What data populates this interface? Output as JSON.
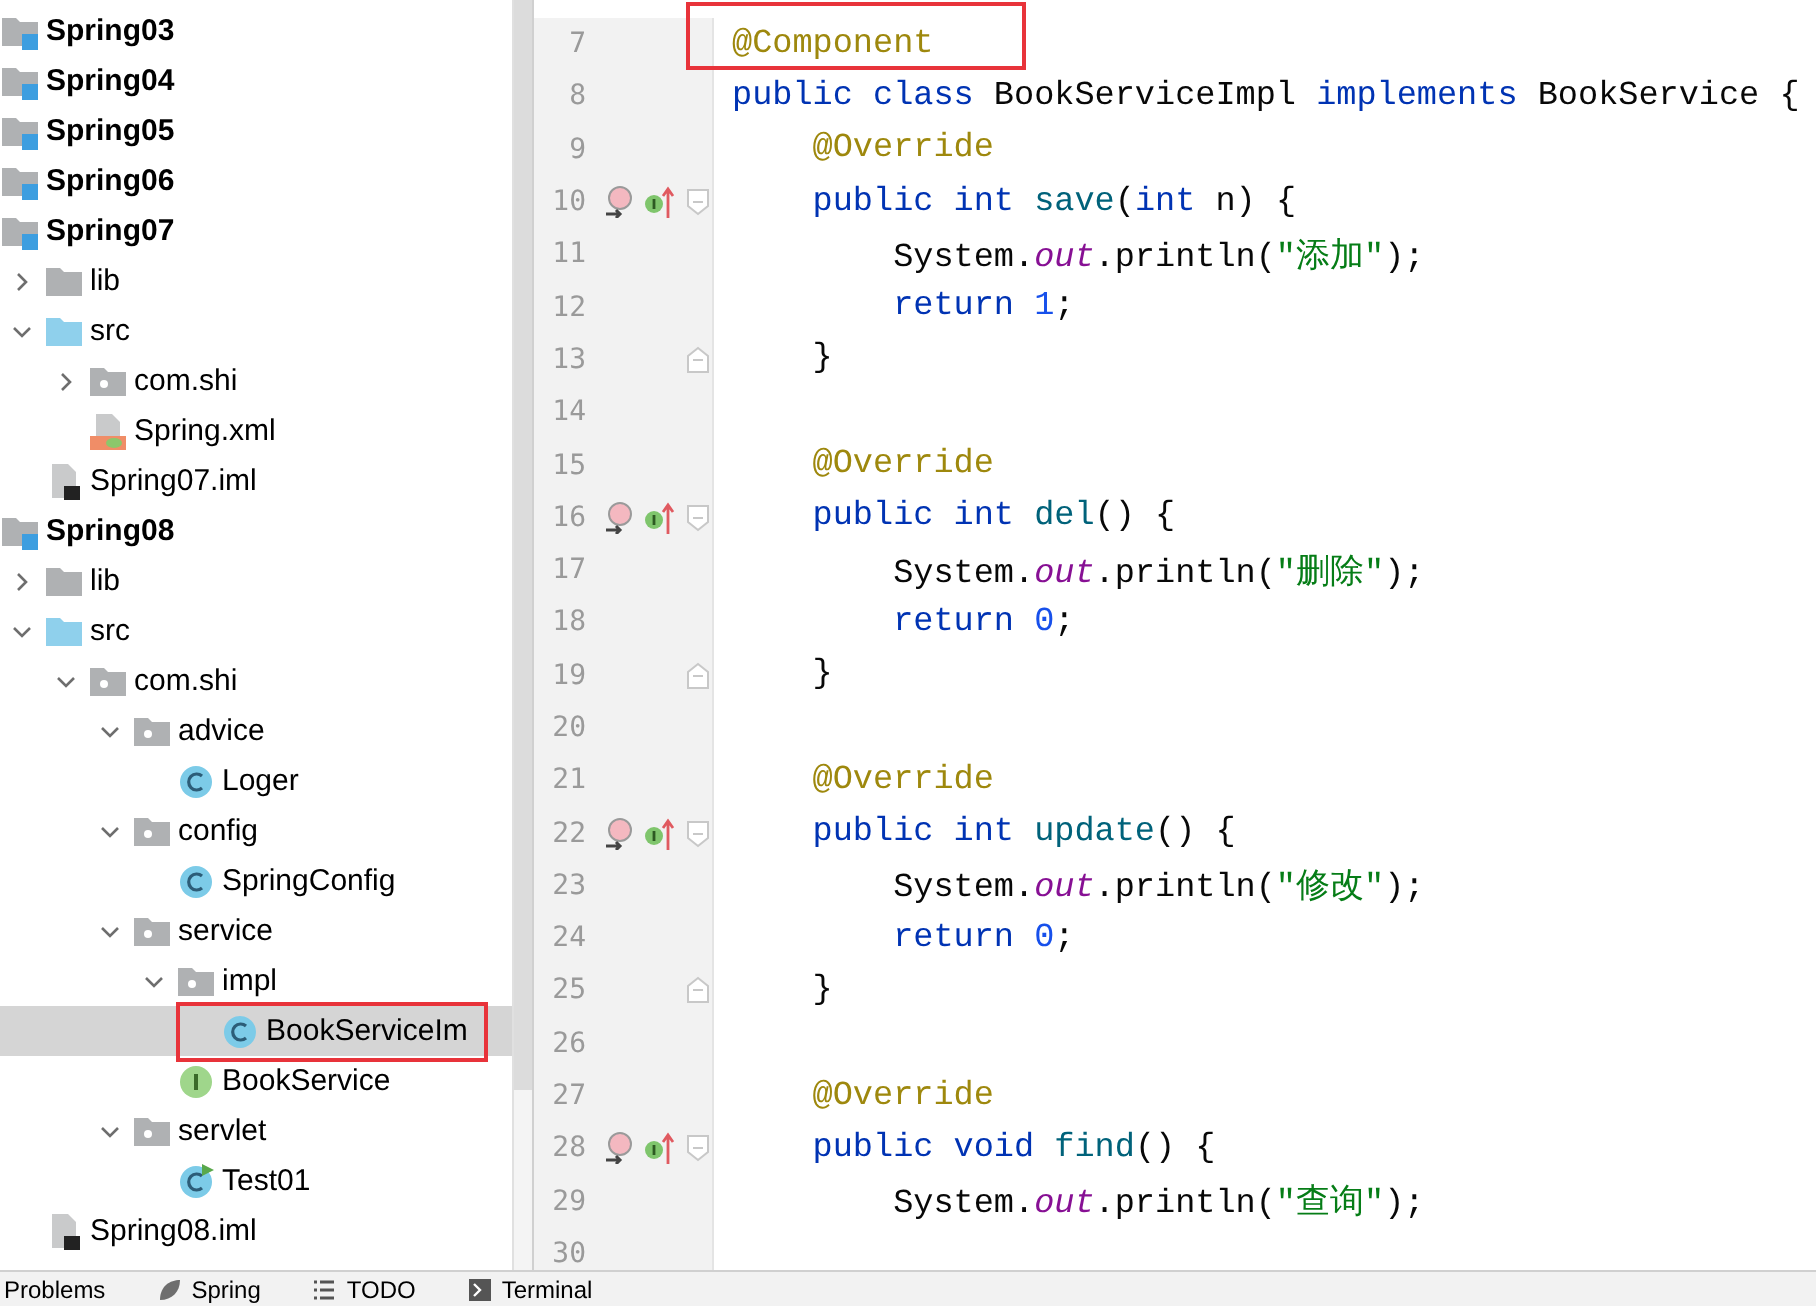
{
  "project_tree": [
    {
      "label": "Spring03",
      "kind": "module"
    },
    {
      "label": "Spring04",
      "kind": "module"
    },
    {
      "label": "Spring05",
      "kind": "module"
    },
    {
      "label": "Spring06",
      "kind": "module"
    },
    {
      "label": "Spring07",
      "kind": "module",
      "children": [
        {
          "label": "lib",
          "kind": "folder",
          "expanded": false
        },
        {
          "label": "src",
          "kind": "source-folder",
          "expanded": true,
          "children": [
            {
              "label": "com.shi",
              "kind": "package",
              "expanded": false
            },
            {
              "label": "Spring.xml",
              "kind": "xml"
            }
          ]
        },
        {
          "label": "Spring07.iml",
          "kind": "iml"
        }
      ]
    },
    {
      "label": "Spring08",
      "kind": "module",
      "children": [
        {
          "label": "lib",
          "kind": "folder",
          "expanded": false
        },
        {
          "label": "src",
          "kind": "source-folder",
          "expanded": true,
          "children": [
            {
              "label": "com.shi",
              "kind": "package",
              "expanded": true,
              "children": [
                {
                  "label": "advice",
                  "kind": "package",
                  "expanded": true,
                  "children": [
                    {
                      "label": "Loger",
                      "kind": "class"
                    }
                  ]
                },
                {
                  "label": "config",
                  "kind": "package",
                  "expanded": true,
                  "children": [
                    {
                      "label": "SpringConfig",
                      "kind": "class"
                    }
                  ]
                },
                {
                  "label": "service",
                  "kind": "package",
                  "expanded": true,
                  "children": [
                    {
                      "label": "impl",
                      "kind": "package",
                      "expanded": true,
                      "children": [
                        {
                          "label": "BookServiceIm",
                          "kind": "class",
                          "selected": true,
                          "highlighted": true
                        }
                      ]
                    },
                    {
                      "label": "BookService",
                      "kind": "interface"
                    }
                  ]
                },
                {
                  "label": "servlet",
                  "kind": "package",
                  "expanded": true,
                  "children": [
                    {
                      "label": "Test01",
                      "kind": "runnable-class"
                    }
                  ]
                }
              ]
            }
          ]
        },
        {
          "label": "Spring08.iml",
          "kind": "iml"
        }
      ]
    }
  ],
  "editor": {
    "lines": [
      {
        "number": "7",
        "highlighted": true,
        "overrides": false,
        "fold_start": false,
        "fold_end": false,
        "tokens": [
          {
            "text": "@Component",
            "kind": "annotation"
          }
        ]
      },
      {
        "number": "8",
        "overrides": false,
        "fold_start": false,
        "fold_end": false,
        "tokens": [
          {
            "text": "public class",
            "kind": "keyword"
          },
          {
            "text": " BookServiceImpl ",
            "kind": "plain"
          },
          {
            "text": "implements",
            "kind": "keyword"
          },
          {
            "text": " BookService {",
            "kind": "plain"
          }
        ]
      },
      {
        "number": "9",
        "overrides": false,
        "fold_start": false,
        "fold_end": false,
        "tokens": [
          {
            "text": "    @Override",
            "kind": "annotation"
          }
        ]
      },
      {
        "number": "10",
        "overrides": true,
        "fold_start": true,
        "fold_end": false,
        "tokens": [
          {
            "text": "    public int ",
            "kind": "keyword"
          },
          {
            "text": "save",
            "kind": "method"
          },
          {
            "text": "(",
            "kind": "plain"
          },
          {
            "text": "int",
            "kind": "keyword"
          },
          {
            "text": " n) {",
            "kind": "plain"
          }
        ]
      },
      {
        "number": "11",
        "overrides": false,
        "fold_start": false,
        "fold_end": false,
        "tokens": [
          {
            "text": "        System.",
            "kind": "plain"
          },
          {
            "text": "out",
            "kind": "field"
          },
          {
            "text": ".println(",
            "kind": "plain"
          },
          {
            "text": "\"添加\"",
            "kind": "string"
          },
          {
            "text": ");",
            "kind": "plain"
          }
        ]
      },
      {
        "number": "12",
        "overrides": false,
        "fold_start": false,
        "fold_end": false,
        "tokens": [
          {
            "text": "        return ",
            "kind": "keyword"
          },
          {
            "text": "1",
            "kind": "number"
          },
          {
            "text": ";",
            "kind": "plain"
          }
        ]
      },
      {
        "number": "13",
        "overrides": false,
        "fold_start": false,
        "fold_end": true,
        "tokens": [
          {
            "text": "    }",
            "kind": "plain"
          }
        ]
      },
      {
        "number": "14",
        "overrides": false,
        "fold_start": false,
        "fold_end": false
      },
      {
        "number": "15",
        "overrides": false,
        "fold_start": false,
        "fold_end": false,
        "tokens": [
          {
            "text": "    @Override",
            "kind": "annotation"
          }
        ]
      },
      {
        "number": "16",
        "overrides": true,
        "fold_start": true,
        "fold_end": false,
        "tokens": [
          {
            "text": "    public int ",
            "kind": "keyword"
          },
          {
            "text": "del",
            "kind": "method"
          },
          {
            "text": "() {",
            "kind": "plain"
          }
        ]
      },
      {
        "number": "17",
        "overrides": false,
        "fold_start": false,
        "fold_end": false,
        "tokens": [
          {
            "text": "        System.",
            "kind": "plain"
          },
          {
            "text": "out",
            "kind": "field"
          },
          {
            "text": ".println(",
            "kind": "plain"
          },
          {
            "text": "\"删除\"",
            "kind": "string"
          },
          {
            "text": ");",
            "kind": "plain"
          }
        ]
      },
      {
        "number": "18",
        "overrides": false,
        "fold_start": false,
        "fold_end": false,
        "tokens": [
          {
            "text": "        return ",
            "kind": "keyword"
          },
          {
            "text": "0",
            "kind": "number"
          },
          {
            "text": ";",
            "kind": "plain"
          }
        ]
      },
      {
        "number": "19",
        "overrides": false,
        "fold_start": false,
        "fold_end": true,
        "tokens": [
          {
            "text": "    }",
            "kind": "plain"
          }
        ]
      },
      {
        "number": "20",
        "overrides": false,
        "fold_start": false,
        "fold_end": false
      },
      {
        "number": "21",
        "overrides": false,
        "fold_start": false,
        "fold_end": false,
        "tokens": [
          {
            "text": "    @Override",
            "kind": "annotation"
          }
        ]
      },
      {
        "number": "22",
        "overrides": true,
        "fold_start": true,
        "fold_end": false,
        "tokens": [
          {
            "text": "    public int ",
            "kind": "keyword"
          },
          {
            "text": "update",
            "kind": "method"
          },
          {
            "text": "() {",
            "kind": "plain"
          }
        ]
      },
      {
        "number": "23",
        "overrides": false,
        "fold_start": false,
        "fold_end": false,
        "tokens": [
          {
            "text": "        System.",
            "kind": "plain"
          },
          {
            "text": "out",
            "kind": "field"
          },
          {
            "text": ".println(",
            "kind": "plain"
          },
          {
            "text": "\"修改\"",
            "kind": "string"
          },
          {
            "text": ");",
            "kind": "plain"
          }
        ]
      },
      {
        "number": "24",
        "overrides": false,
        "fold_start": false,
        "fold_end": false,
        "tokens": [
          {
            "text": "        return ",
            "kind": "keyword"
          },
          {
            "text": "0",
            "kind": "number"
          },
          {
            "text": ";",
            "kind": "plain"
          }
        ]
      },
      {
        "number": "25",
        "overrides": false,
        "fold_start": false,
        "fold_end": true,
        "tokens": [
          {
            "text": "    }",
            "kind": "plain"
          }
        ]
      },
      {
        "number": "26",
        "overrides": false,
        "fold_start": false,
        "fold_end": false
      },
      {
        "number": "27",
        "overrides": false,
        "fold_start": false,
        "fold_end": false,
        "tokens": [
          {
            "text": "    @Override",
            "kind": "annotation"
          }
        ]
      },
      {
        "number": "28",
        "overrides": true,
        "fold_start": true,
        "fold_end": false,
        "tokens": [
          {
            "text": "    public void ",
            "kind": "keyword"
          },
          {
            "text": "find",
            "kind": "method"
          },
          {
            "text": "() {",
            "kind": "plain"
          }
        ]
      },
      {
        "number": "29",
        "overrides": false,
        "fold_start": false,
        "fold_end": false,
        "tokens": [
          {
            "text": "        System.",
            "kind": "plain"
          },
          {
            "text": "out",
            "kind": "field"
          },
          {
            "text": ".println(",
            "kind": "plain"
          },
          {
            "text": "\"查询\"",
            "kind": "string"
          },
          {
            "text": ");",
            "kind": "plain"
          }
        ]
      },
      {
        "number": "30",
        "overrides": false,
        "fold_start": false,
        "fold_end": false
      }
    ]
  },
  "bottom_tabs": [
    {
      "label": "Problems",
      "kind": "problems"
    },
    {
      "label": "Spring",
      "kind": "spring"
    },
    {
      "label": "TODO",
      "kind": "todo"
    },
    {
      "label": "Terminal",
      "kind": "terminal"
    }
  ]
}
